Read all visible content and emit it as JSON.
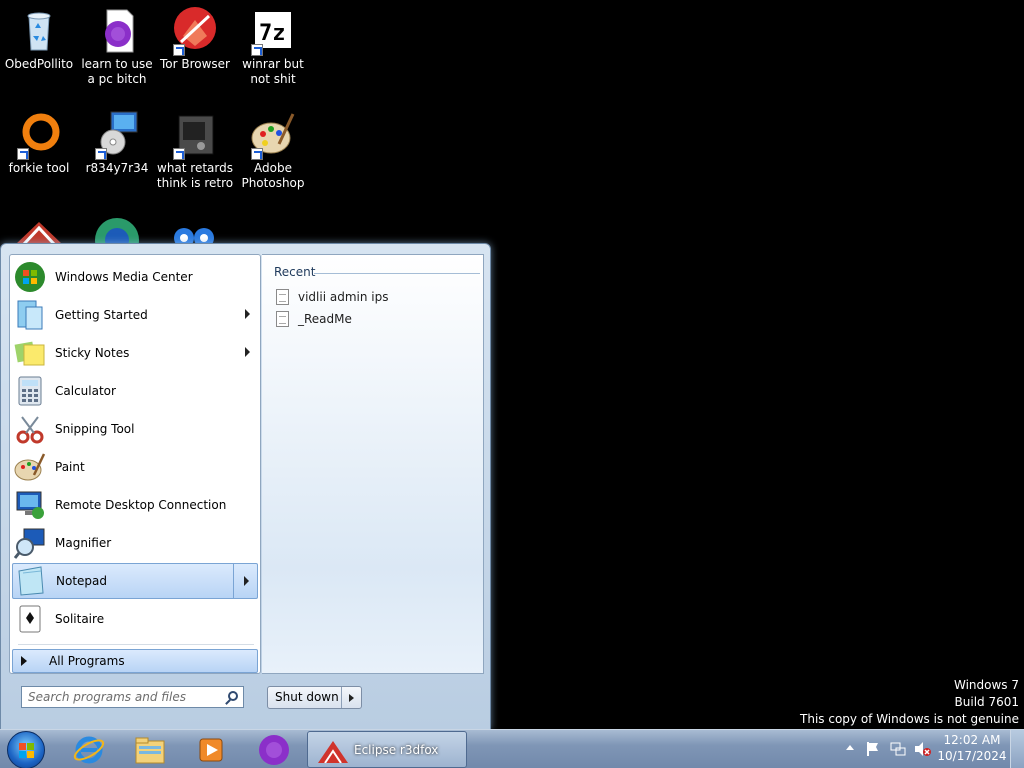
{
  "desktop": {
    "icons": [
      {
        "label": "ObedPollito",
        "icon": "recycle-bin-icon"
      },
      {
        "label": "learn to use a pc bitch",
        "icon": "media-file-icon"
      },
      {
        "label": "Tor Browser",
        "icon": "tor-browser-icon"
      },
      {
        "label": "winrar but not shit",
        "icon": "7zip-icon"
      },
      {
        "label": "forkie tool",
        "icon": "orange-ring-icon"
      },
      {
        "label": "r834y7r34",
        "icon": "computer-disc-icon"
      },
      {
        "label": "what retards think is retro",
        "icon": "retro-app-icon"
      },
      {
        "label": "Adobe Photoshop",
        "icon": "paint-palette-icon"
      }
    ]
  },
  "start_menu": {
    "programs": [
      {
        "label": "Windows Media Center",
        "icon": "windows-media-center-icon",
        "submenu": false
      },
      {
        "label": "Getting Started",
        "icon": "getting-started-icon",
        "submenu": true
      },
      {
        "label": "Sticky Notes",
        "icon": "sticky-notes-icon",
        "submenu": true
      },
      {
        "label": "Calculator",
        "icon": "calculator-icon",
        "submenu": false
      },
      {
        "label": "Snipping Tool",
        "icon": "snipping-tool-icon",
        "submenu": false
      },
      {
        "label": "Paint",
        "icon": "paint-icon",
        "submenu": false
      },
      {
        "label": "Remote Desktop Connection",
        "icon": "remote-desktop-icon",
        "submenu": false
      },
      {
        "label": "Magnifier",
        "icon": "magnifier-icon",
        "submenu": false
      },
      {
        "label": "Notepad",
        "icon": "notepad-icon",
        "submenu": true
      },
      {
        "label": "Solitaire",
        "icon": "solitaire-icon",
        "submenu": false
      }
    ],
    "all_programs_label": "All Programs",
    "recent": {
      "title": "Recent",
      "items": [
        "vidlii admin ips",
        "_ReadMe"
      ]
    },
    "search_placeholder": "Search programs and files",
    "shutdown_label": "Shut down"
  },
  "taskbar": {
    "pinned": [
      "internet-explorer-icon",
      "windows-explorer-icon",
      "media-player-icon",
      "media-file-icon"
    ],
    "active_window": "Eclipse r3dfox",
    "clock": {
      "time": "12:02 AM",
      "date": "10/17/2024"
    }
  },
  "watermark": {
    "line1": "Windows 7",
    "line2": "Build 7601",
    "line3": "This copy of Windows is not genuine"
  },
  "colors": {
    "accent": "#1c64c4",
    "taskbar": "#7f96b6",
    "menu_highlight": "#b8d4f5"
  }
}
